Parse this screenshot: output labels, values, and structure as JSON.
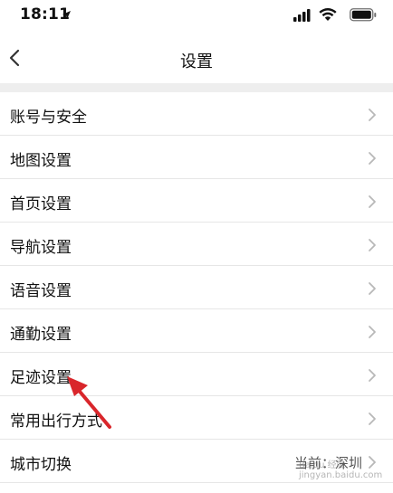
{
  "status_bar": {
    "time": "18:11"
  },
  "nav": {
    "title": "设置"
  },
  "settings": {
    "items": [
      {
        "label": "账号与安全",
        "value": ""
      },
      {
        "label": "地图设置",
        "value": ""
      },
      {
        "label": "首页设置",
        "value": ""
      },
      {
        "label": "导航设置",
        "value": ""
      },
      {
        "label": "语音设置",
        "value": ""
      },
      {
        "label": "通勤设置",
        "value": ""
      },
      {
        "label": "足迹设置",
        "value": ""
      },
      {
        "label": "常用出行方式",
        "value": ""
      },
      {
        "label": "城市切换",
        "value": "当前：深圳"
      }
    ]
  },
  "watermark": {
    "text": "Baidu 经验",
    "url_text": "jingyan.baidu.com"
  },
  "colors": {
    "background": "#ffffff",
    "divider": "#e6e6e6",
    "section_gap": "#eeeeee",
    "annotation_arrow": "#d9262b",
    "chevron": "#b8b8b8"
  }
}
